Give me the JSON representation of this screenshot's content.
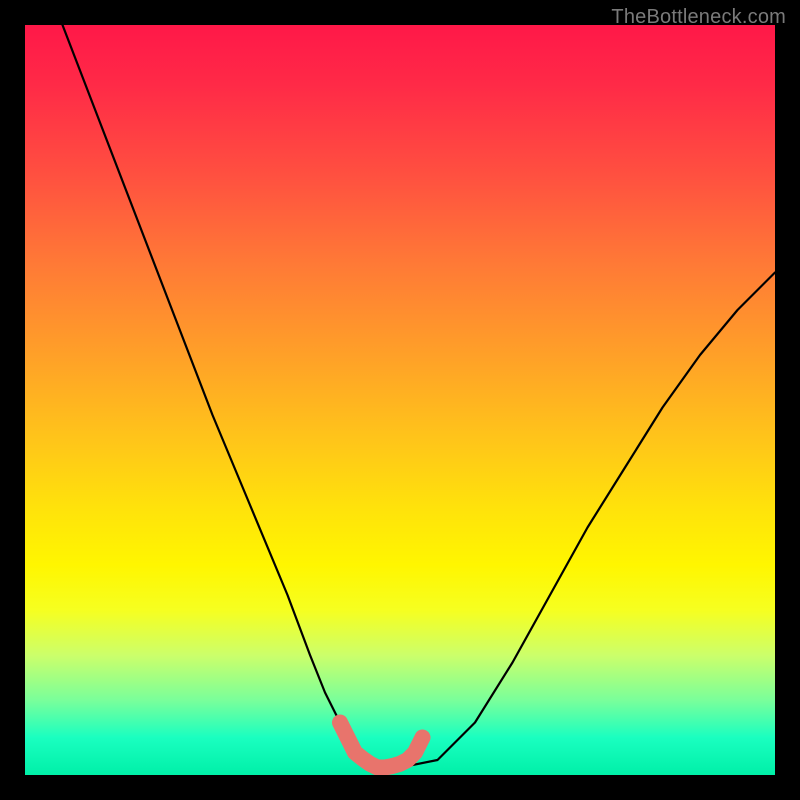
{
  "watermark": "TheBottleneck.com",
  "colors": {
    "background": "#000000",
    "line": "#000000",
    "marker": "#e8746c",
    "watermark_text": "#7a7a7a",
    "gradient_top": "#ff1848",
    "gradient_bottom": "#00f0a8"
  },
  "chart_data": {
    "type": "line",
    "title": "",
    "xlabel": "",
    "ylabel": "",
    "xlim": [
      0,
      100
    ],
    "ylim": [
      0,
      100
    ],
    "grid": false,
    "series": [
      {
        "name": "curve",
        "x": [
          5,
          10,
          15,
          20,
          25,
          30,
          35,
          38,
          40,
          42,
          45,
          46,
          47,
          50,
          55,
          60,
          65,
          70,
          75,
          80,
          85,
          90,
          95,
          100
        ],
        "y": [
          100,
          87,
          74,
          61,
          48,
          36,
          24,
          16,
          11,
          7,
          3,
          2,
          1,
          1,
          2,
          7,
          15,
          24,
          33,
          41,
          49,
          56,
          62,
          67
        ]
      }
    ],
    "highlight_points": {
      "name": "marker",
      "x": [
        42,
        43,
        44,
        45,
        46,
        47,
        48,
        49,
        50,
        51,
        52,
        53
      ],
      "y": [
        7,
        5,
        3,
        2.2,
        1.5,
        1,
        1,
        1.2,
        1.5,
        2,
        3,
        5
      ]
    }
  }
}
